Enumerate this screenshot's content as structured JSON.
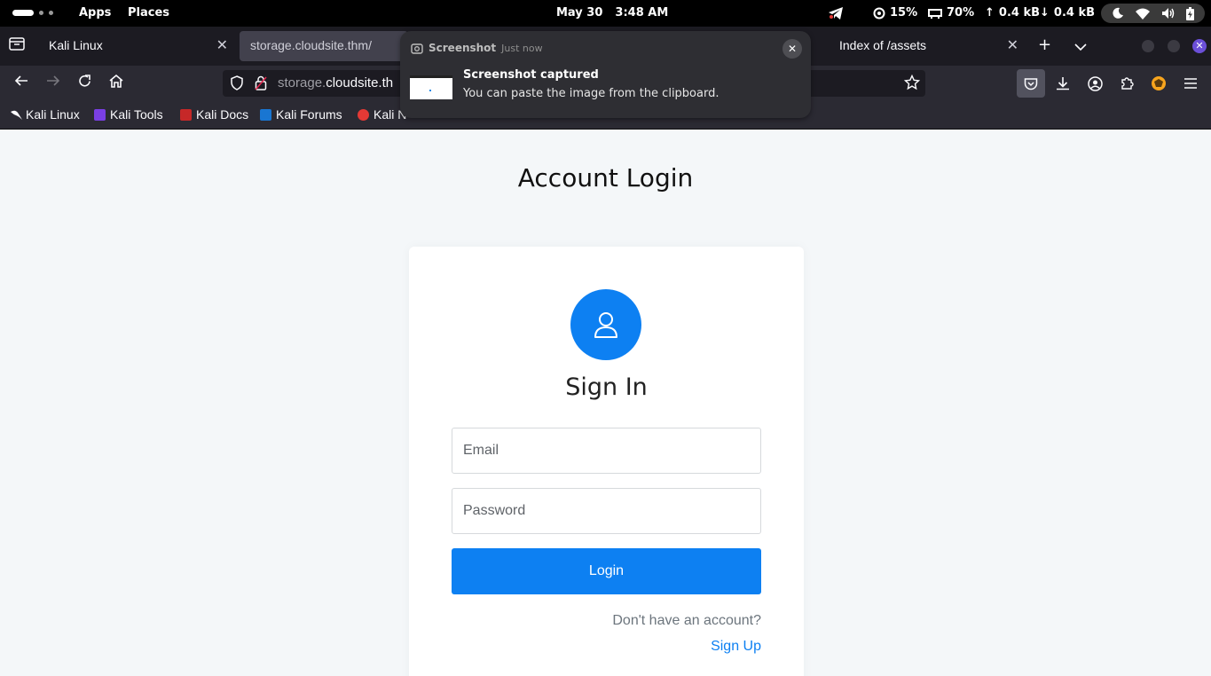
{
  "topbar": {
    "apps_label": "Apps",
    "places_label": "Places",
    "date": "May 30",
    "time": "3:48 AM",
    "cpu": "15%",
    "memory": "70%",
    "upload": "0.4 kB",
    "download": "0.4 kB"
  },
  "browser": {
    "tabs": [
      {
        "title": "Kali Linux",
        "active": false
      },
      {
        "title": "storage.cloudsite.thm/",
        "active": true
      },
      {
        "title": "Index of /assets",
        "active": false
      }
    ],
    "url_prefix": "storage.",
    "url_domain": "cloudsite.th",
    "bookmarks": [
      "Kali Linux",
      "Kali Tools",
      "Kali Docs",
      "Kali Forums",
      "Kali N"
    ]
  },
  "notification": {
    "app_name": "Screenshot",
    "timestamp": "Just now",
    "title": "Screenshot captured",
    "body": "You can paste the image from the clipboard."
  },
  "page": {
    "heading": "Account Login",
    "card": {
      "title": "Sign In",
      "email_placeholder": "Email",
      "password_placeholder": "Password",
      "login_label": "Login",
      "no_account_text": "Don't have an account?",
      "signup_label": "Sign Up"
    }
  },
  "colors": {
    "accent": "#0d80f2",
    "page_bg": "#f4f7f9"
  }
}
